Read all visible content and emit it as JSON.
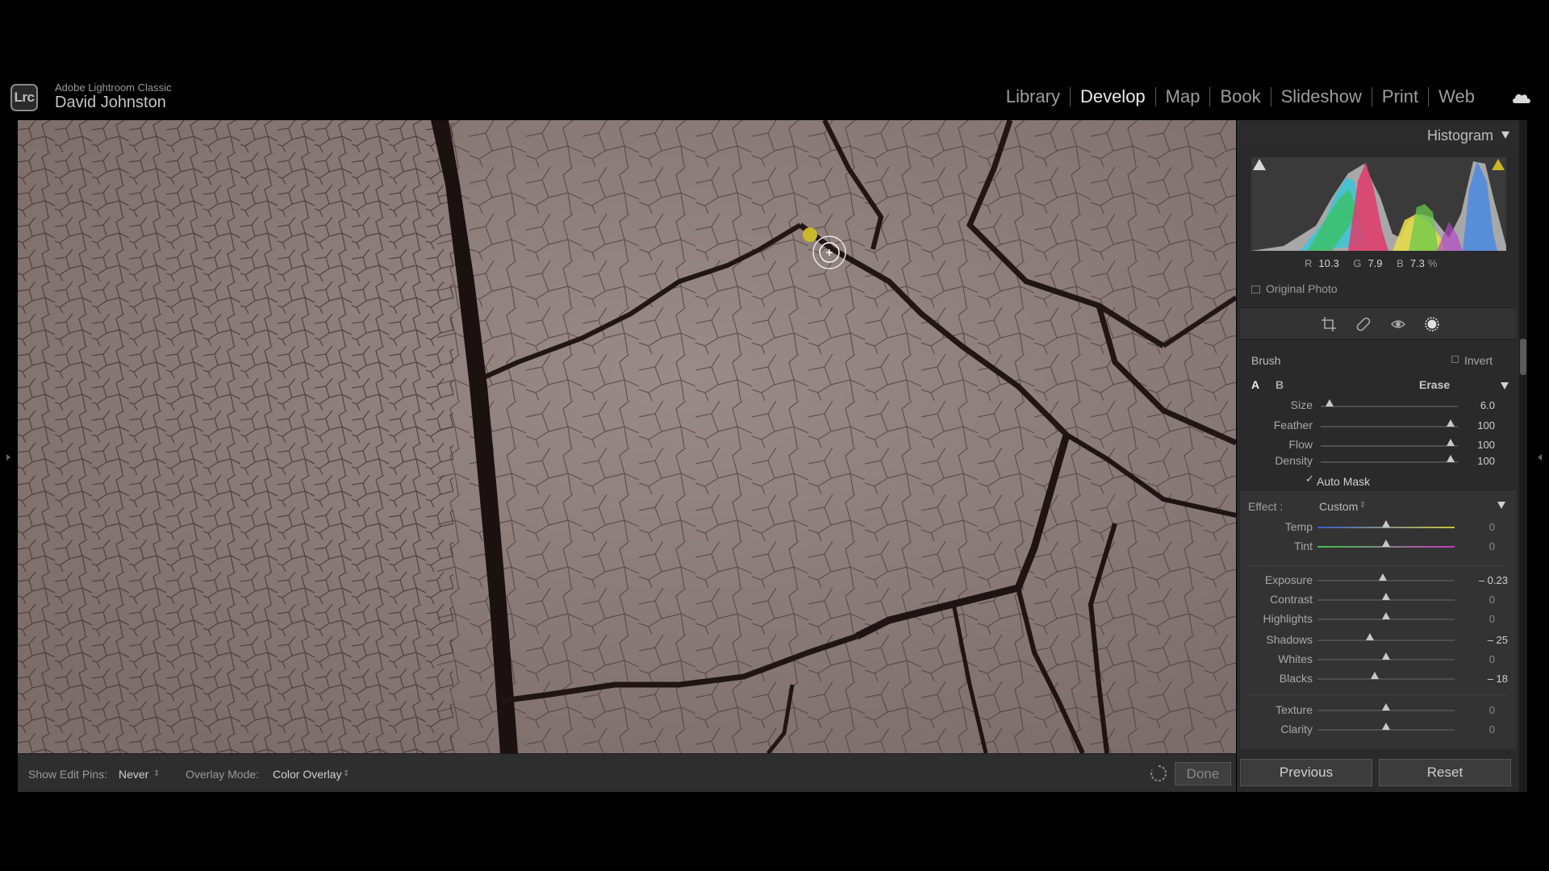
{
  "app": {
    "name": "Adobe Lightroom Classic",
    "logo_text": "Lrc",
    "user": "David Johnston"
  },
  "modules": [
    {
      "label": "Library",
      "active": false
    },
    {
      "label": "Develop",
      "active": true
    },
    {
      "label": "Map",
      "active": false
    },
    {
      "label": "Book",
      "active": false
    },
    {
      "label": "Slideshow",
      "active": false
    },
    {
      "label": "Print",
      "active": false
    },
    {
      "label": "Web",
      "active": false
    }
  ],
  "histogram": {
    "title": "Histogram",
    "r_label": "R",
    "r_value": "10.3",
    "g_label": "G",
    "g_value": "7.9",
    "b_label": "B",
    "b_value": "7.3",
    "percent": "%",
    "original_photo": "Original Photo"
  },
  "brush": {
    "title": "Brush",
    "invert": "Invert",
    "tab_a": "A",
    "tab_b": "B",
    "erase": "Erase",
    "size_label": "Size",
    "size_value": "6.0",
    "feather_label": "Feather",
    "feather_value": "100",
    "flow_label": "Flow",
    "flow_value": "100",
    "density_label": "Density",
    "density_value": "100",
    "auto_mask": "Auto Mask"
  },
  "effect": {
    "label": "Effect :",
    "preset": "Custom",
    "temp_label": "Temp",
    "temp_value": "0",
    "tint_label": "Tint",
    "tint_value": "0",
    "exposure_label": "Exposure",
    "exposure_value": "– 0.23",
    "contrast_label": "Contrast",
    "contrast_value": "0",
    "highlights_label": "Highlights",
    "highlights_value": "0",
    "shadows_label": "Shadows",
    "shadows_value": "– 25",
    "whites_label": "Whites",
    "whites_value": "0",
    "blacks_label": "Blacks",
    "blacks_value": "– 18",
    "texture_label": "Texture",
    "texture_value": "0",
    "clarity_label": "Clarity",
    "clarity_value": "0"
  },
  "toolbar": {
    "show_pins_label": "Show Edit Pins:",
    "show_pins_value": "Never",
    "overlay_label": "Overlay Mode:",
    "overlay_value": "Color Overlay",
    "done": "Done"
  },
  "buttons": {
    "previous": "Previous",
    "reset": "Reset"
  },
  "colors": {
    "pin_yellow": "#c9b82a",
    "mud": "#8a7a78"
  }
}
